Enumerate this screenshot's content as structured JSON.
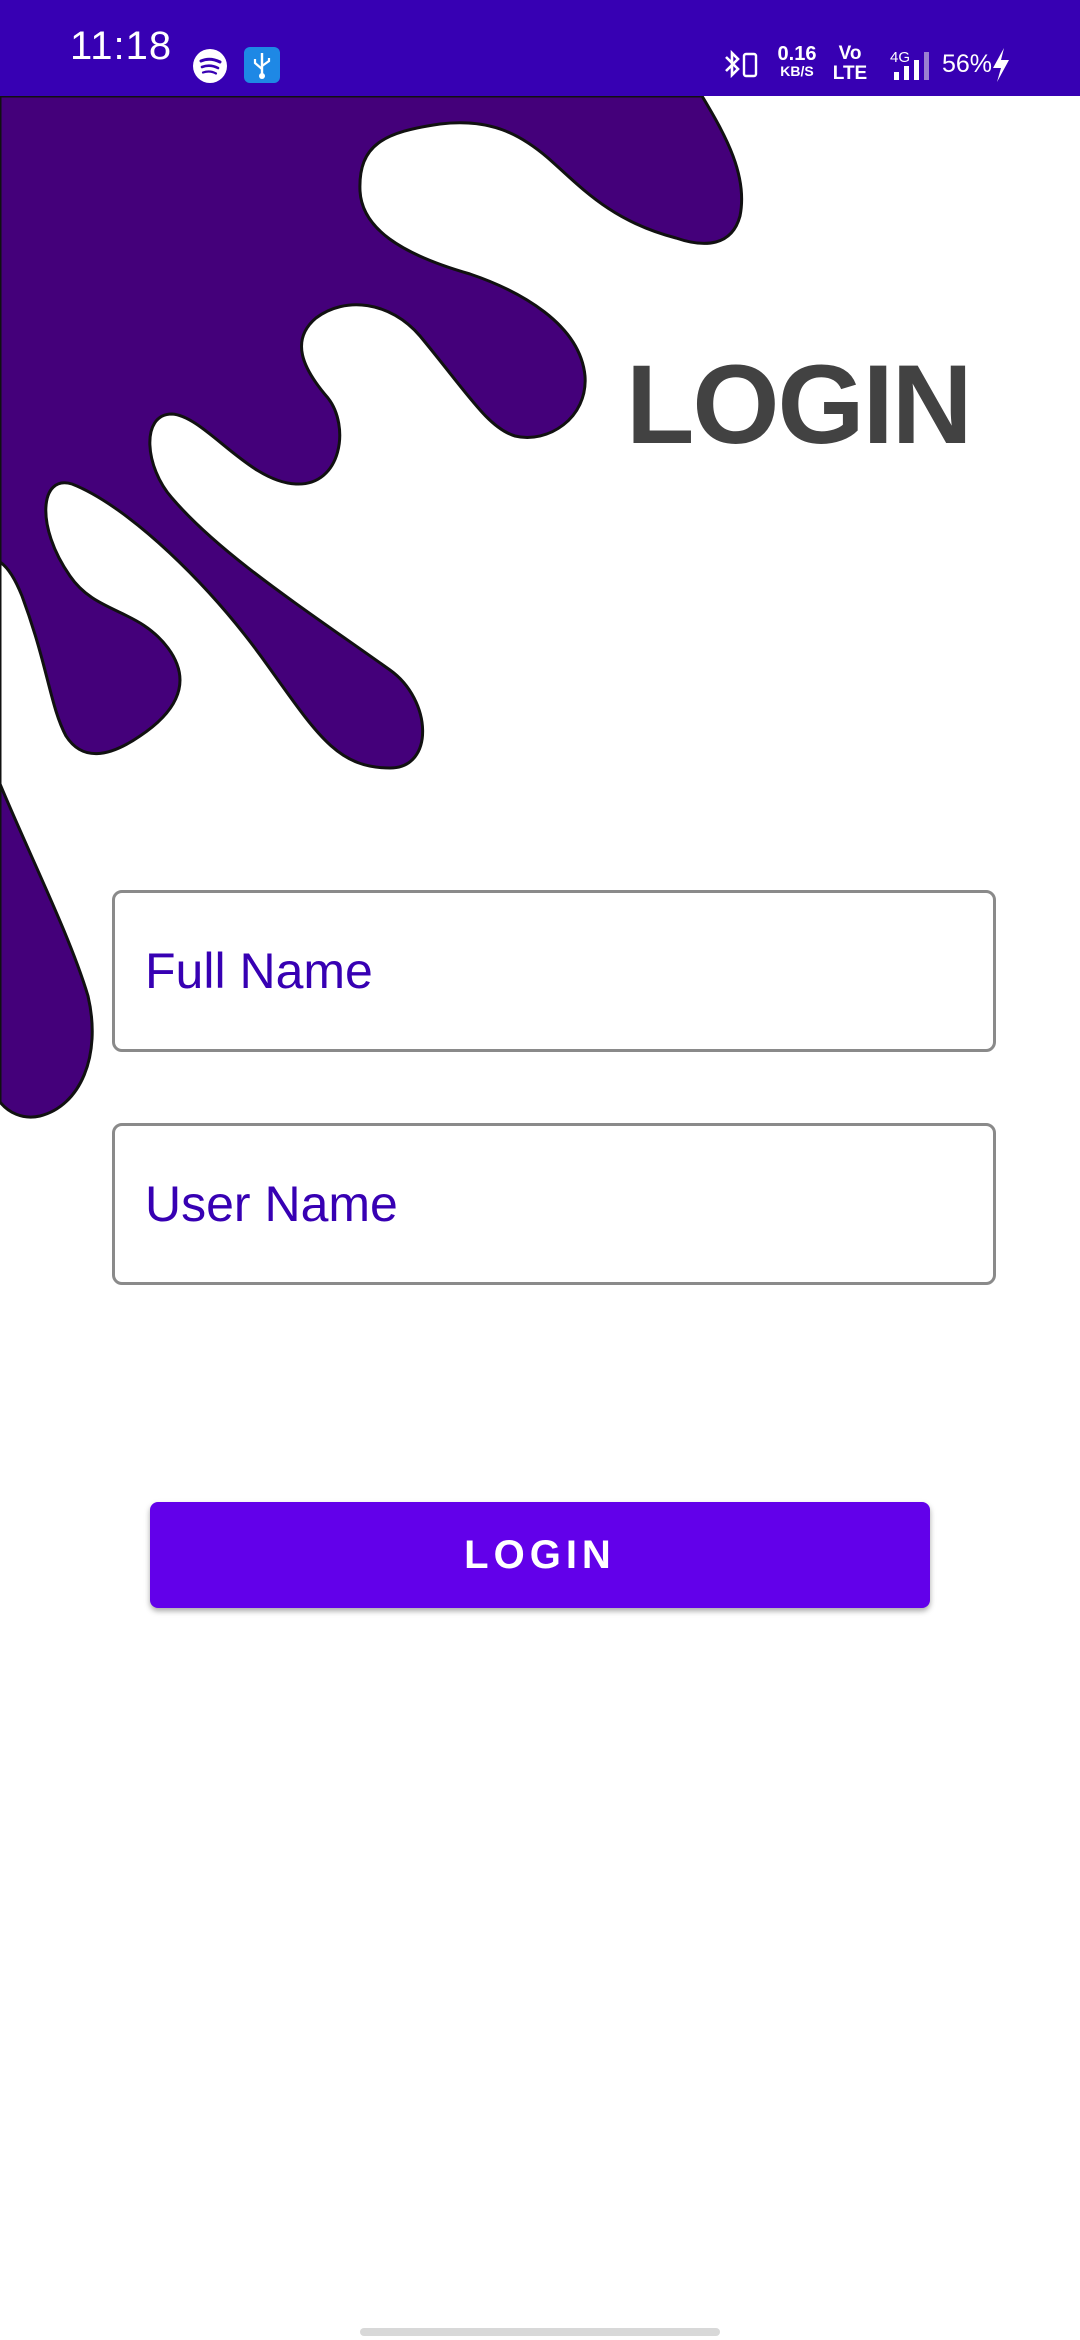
{
  "status_bar": {
    "time": "11:18",
    "net_speed_value": "0.16",
    "net_speed_unit": "KB/S",
    "volte_top": "Vo",
    "volte_bottom": "LTE",
    "network_type": "4G",
    "battery": "56%",
    "icons": [
      "spotify-icon",
      "usb-icon",
      "bluetooth-icon",
      "signal-icon",
      "charging-icon"
    ]
  },
  "page": {
    "title": "LOGIN",
    "full_name_placeholder": "Full Name",
    "user_name_placeholder": "User Name",
    "login_button": "LOGIN"
  },
  "colors": {
    "status_bar": "#3700b3",
    "splash": "#44007a",
    "input_text": "#3700b3",
    "button": "#6200ea",
    "title": "#424242"
  }
}
